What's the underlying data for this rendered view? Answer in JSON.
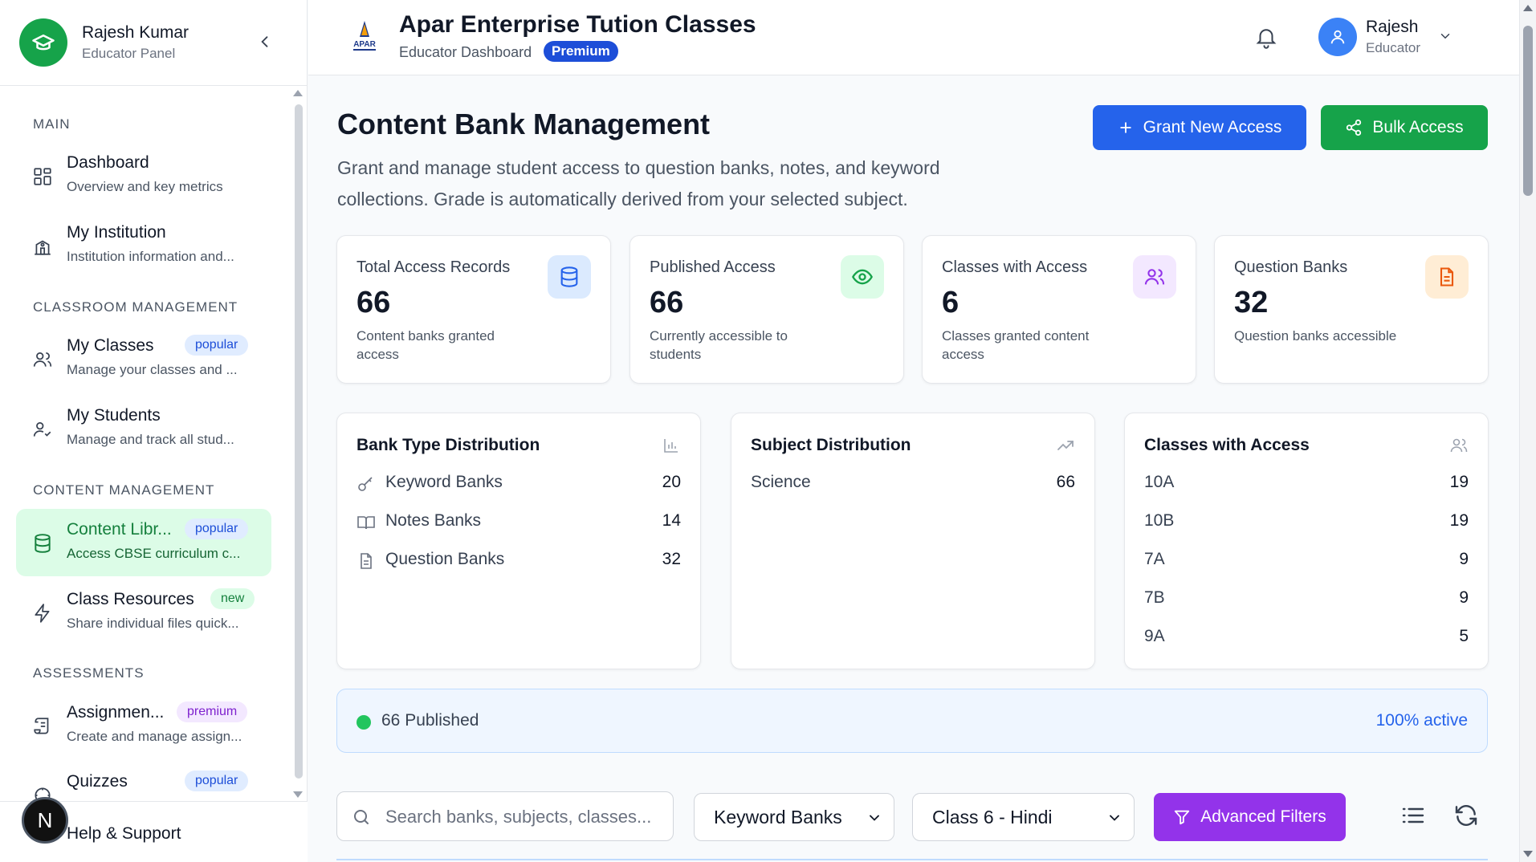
{
  "sidebar": {
    "user_name": "Rajesh Kumar",
    "user_role": "Educator Panel",
    "sections": {
      "main": "MAIN",
      "classroom": "CLASSROOM MANAGEMENT",
      "content": "CONTENT MANAGEMENT",
      "assessments": "ASSESSMENTS"
    },
    "items": {
      "dashboard": {
        "title": "Dashboard",
        "subtitle": "Overview and key metrics"
      },
      "institution": {
        "title": "My Institution",
        "subtitle": "Institution information and..."
      },
      "classes": {
        "title": "My Classes",
        "subtitle": "Manage your classes and ...",
        "badge": "popular"
      },
      "students": {
        "title": "My Students",
        "subtitle": "Manage and track all stud..."
      },
      "content_library": {
        "title": "Content Libr...",
        "subtitle": "Access CBSE curriculum c...",
        "badge": "popular"
      },
      "class_resources": {
        "title": "Class Resources",
        "subtitle": "Share individual files quick...",
        "badge": "new"
      },
      "assignments": {
        "title": "Assignmen...",
        "subtitle": "Create and manage assign...",
        "badge": "premium"
      },
      "quizzes": {
        "title": "Quizzes",
        "badge": "popular"
      }
    },
    "help": "Help & Support",
    "avatar_letter": "N"
  },
  "topbar": {
    "title": "Apar Enterprise Tution Classes",
    "subtitle": "Educator Dashboard",
    "badge": "Premium",
    "logo_text": "APAR",
    "user_name": "Rajesh",
    "user_role": "Educator"
  },
  "page": {
    "title": "Content Bank Management",
    "description": "Grant and manage student access to question banks, notes, and keyword collections. Grade is automatically derived from your selected subject.",
    "grant_button": "Grant New Access",
    "bulk_button": "Bulk Access"
  },
  "stats": [
    {
      "label": "Total Access Records",
      "value": "66",
      "desc": "Content banks granted access",
      "icon": "database-icon",
      "color": "#2563eb"
    },
    {
      "label": "Published Access",
      "value": "66",
      "desc": "Currently accessible to students",
      "icon": "eye-icon",
      "color": "#16a34a"
    },
    {
      "label": "Classes with Access",
      "value": "6",
      "desc": "Classes granted content access",
      "icon": "users-icon",
      "color": "#9333ea"
    },
    {
      "label": "Question Banks",
      "value": "32",
      "desc": "Question banks accessible",
      "icon": "file-icon",
      "color": "#ea580c"
    }
  ],
  "bank_type": {
    "title": "Bank Type Distribution",
    "rows": [
      {
        "label": "Keyword Banks",
        "value": "20"
      },
      {
        "label": "Notes Banks",
        "value": "14"
      },
      {
        "label": "Question Banks",
        "value": "32"
      }
    ]
  },
  "subject": {
    "title": "Subject Distribution",
    "rows": [
      {
        "label": "Science",
        "value": "66"
      }
    ]
  },
  "classes_access": {
    "title": "Classes with Access",
    "rows": [
      {
        "label": "10A",
        "value": "19"
      },
      {
        "label": "10B",
        "value": "19"
      },
      {
        "label": "7A",
        "value": "9"
      },
      {
        "label": "7B",
        "value": "9"
      },
      {
        "label": "9A",
        "value": "5"
      }
    ]
  },
  "published_bar": {
    "text": "66 Published",
    "active": "100% active"
  },
  "filters": {
    "search_placeholder": "Search banks, subjects, classes...",
    "bank_type_selected": "Keyword Banks",
    "class_selected": "Class 6 - Hindi",
    "advanced_button": "Advanced Filters"
  }
}
